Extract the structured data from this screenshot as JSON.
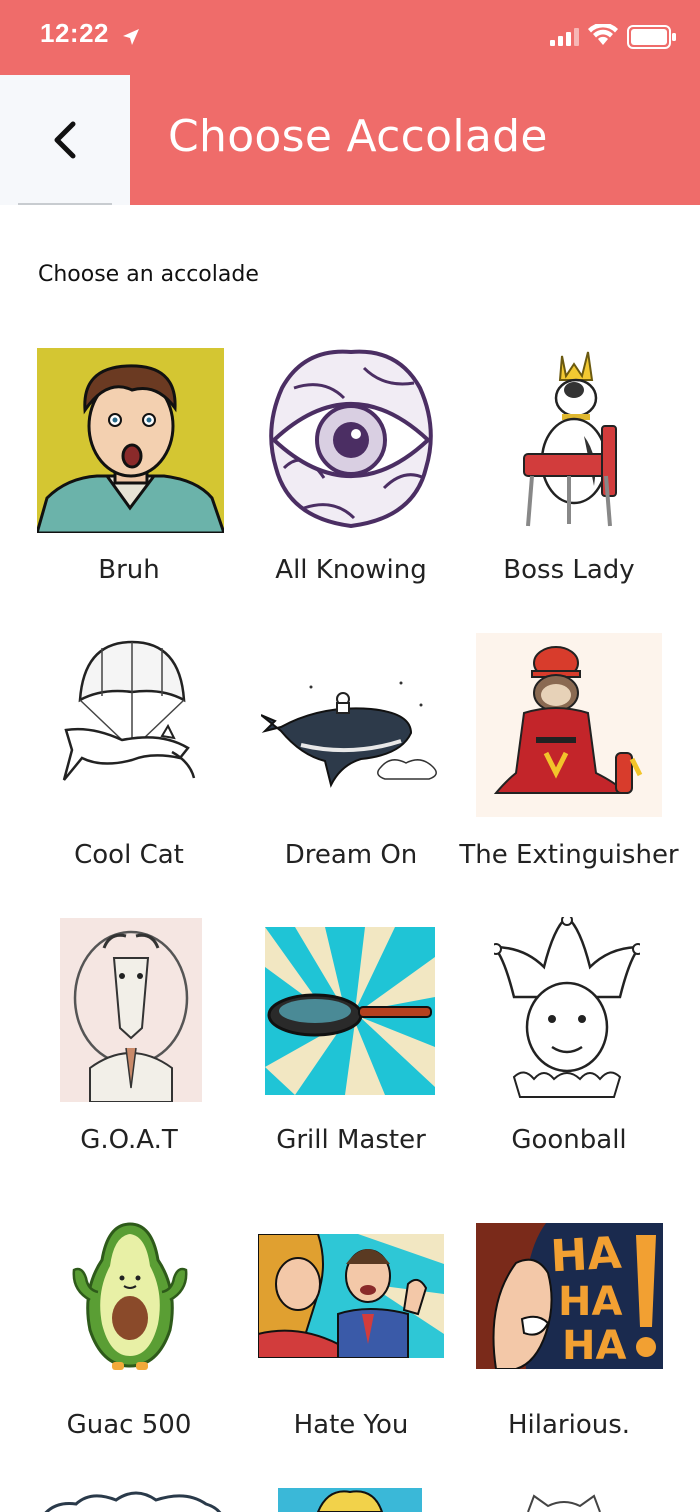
{
  "status_bar": {
    "time": "12:22"
  },
  "header": {
    "title": "Choose Accolade",
    "back_icon": "chevron-left-icon"
  },
  "subtitle": "Choose an accolade",
  "accolades": [
    {
      "label": "Bruh",
      "image": "shocked-man-portrait"
    },
    {
      "label": "All Knowing",
      "image": "eye-brain-illustration"
    },
    {
      "label": "Boss Lady",
      "image": "crowned-cow-on-chair"
    },
    {
      "label": "Cool Cat",
      "image": "cat-with-parachute"
    },
    {
      "label": "Dream On",
      "image": "whale-with-astronaut"
    },
    {
      "label": "The Extinguisher",
      "image": "sloth-firefighter"
    },
    {
      "label": "G.O.A.T",
      "image": "goat-portrait"
    },
    {
      "label": "Grill Master",
      "image": "frying-pan-pop-art"
    },
    {
      "label": "Goonball",
      "image": "jester-portrait"
    },
    {
      "label": "Guac 500",
      "image": "strong-avocado"
    },
    {
      "label": "Hate You",
      "image": "angry-couple-pop-art"
    },
    {
      "label": "Hilarious.",
      "image": "laughing-woman-ha-ha-ha"
    }
  ],
  "haha_text": "HA HA HA!",
  "colors": {
    "header": "#ef6c6a",
    "back_button_bg": "#f6f8fb"
  }
}
